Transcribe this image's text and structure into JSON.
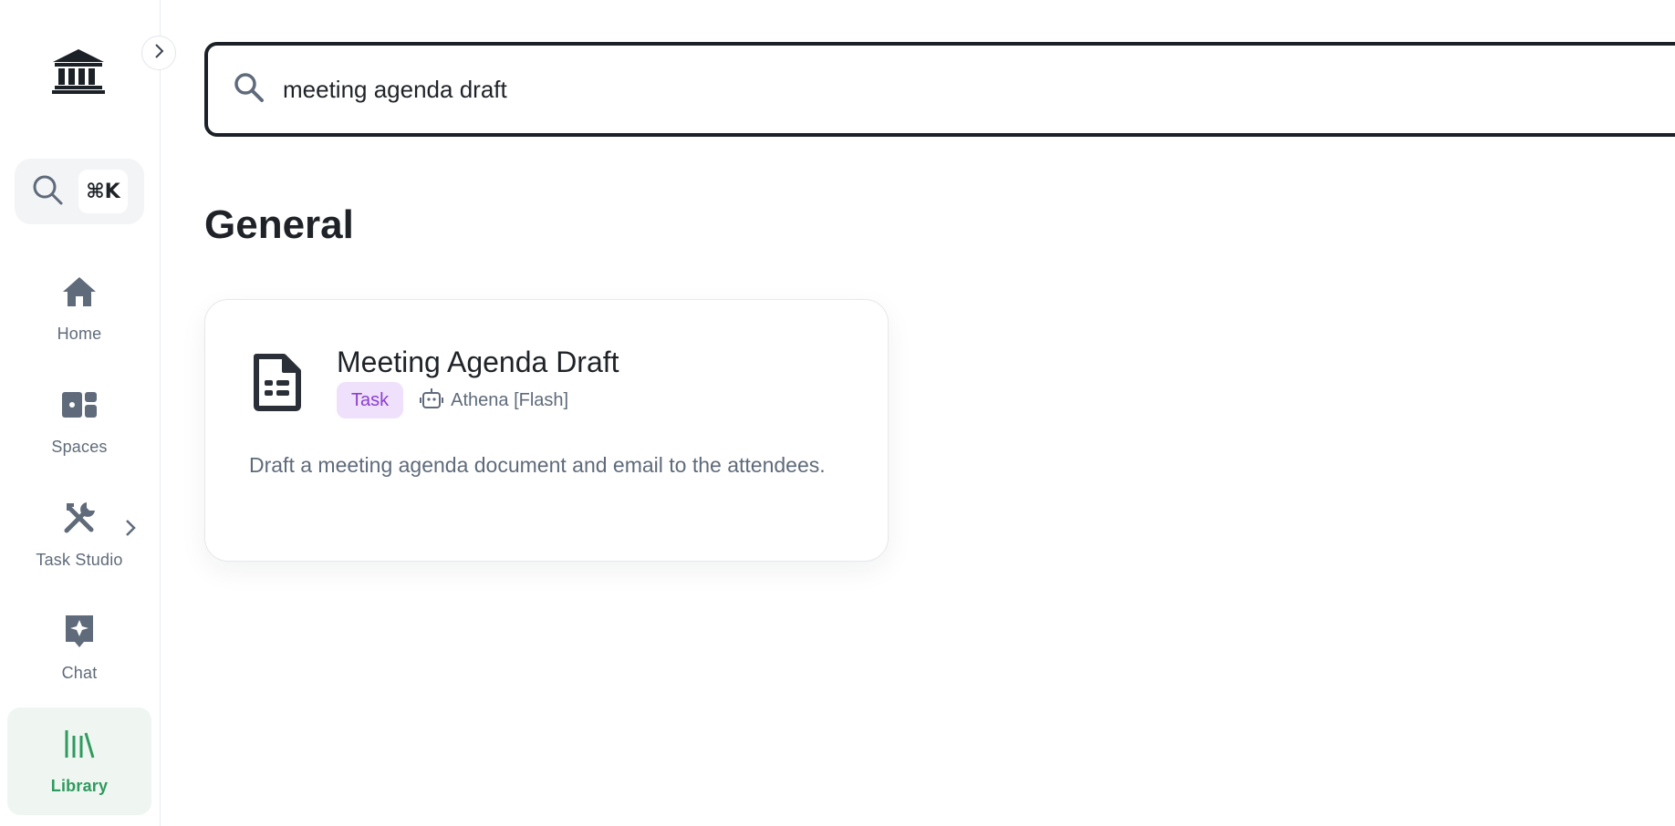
{
  "sidebar": {
    "logo_icon": "bank-building-icon",
    "collapse_icon": "chevron-right-icon",
    "search": {
      "icon": "search-icon",
      "shortcut": "⌘K"
    },
    "nav": [
      {
        "label": "Home",
        "icon": "home-icon",
        "active": false
      },
      {
        "label": "Spaces",
        "icon": "dashboard-icon",
        "active": false
      },
      {
        "label": "Task Studio",
        "icon": "tools-icon",
        "active": false,
        "expandable": true
      },
      {
        "label": "Chat",
        "icon": "sparkle-chat-icon",
        "active": false
      },
      {
        "label": "Library",
        "icon": "library-books-icon",
        "active": true
      }
    ]
  },
  "search": {
    "icon": "search-icon",
    "value": "meeting agenda draft"
  },
  "section": {
    "title": "General"
  },
  "results": [
    {
      "icon": "document-icon",
      "title": "Meeting Agenda Draft",
      "badge": "Task",
      "agent_icon": "robot-icon",
      "agent": "Athena [Flash]",
      "description": "Draft a meeting agenda document and email to the attendees."
    }
  ],
  "colors": {
    "accent_green": "#2f9a5e",
    "active_bg": "#eff6f1",
    "badge_bg": "#efe0fb",
    "badge_text": "#8a3fd0",
    "icon_gray": "#5f6b7a"
  }
}
